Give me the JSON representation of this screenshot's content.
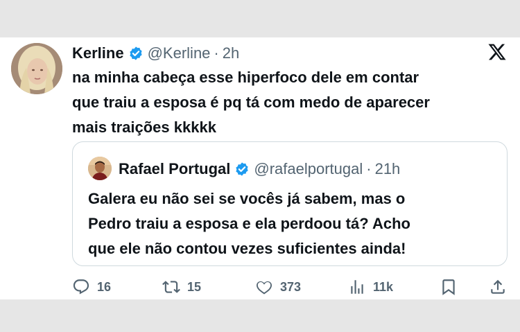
{
  "tweet": {
    "author_name": "Kerline",
    "handle": "@Kerline",
    "separator": "·",
    "time": "2h",
    "text": "na minha cabeça esse hiperfoco dele em contar\nque traiu a esposa é pq tá com medo de aparecer\nmais traições kkkkk"
  },
  "quoted": {
    "author_name": "Rafael Portugal",
    "handle": "@rafaelportugal",
    "separator": "·",
    "time": "21h",
    "text": "Galera eu não sei se vocês já sabem, mas o\nPedro traiu a esposa e ela perdoou tá? Acho\nque ele não contou vezes suficientes ainda!"
  },
  "actions": {
    "replies": "16",
    "retweets": "15",
    "likes": "373",
    "views": "11k"
  },
  "icons": {
    "verified": "verified-badge-icon",
    "platform": "x-logo-icon",
    "reply": "reply-icon",
    "retweet": "retweet-icon",
    "like": "heart-icon",
    "views": "views-icon",
    "bookmark": "bookmark-icon",
    "share": "share-icon"
  },
  "colors": {
    "verified": "#1d9bf0",
    "text": "#0f1419",
    "secondary": "#536471",
    "border": "#cfd9de"
  }
}
